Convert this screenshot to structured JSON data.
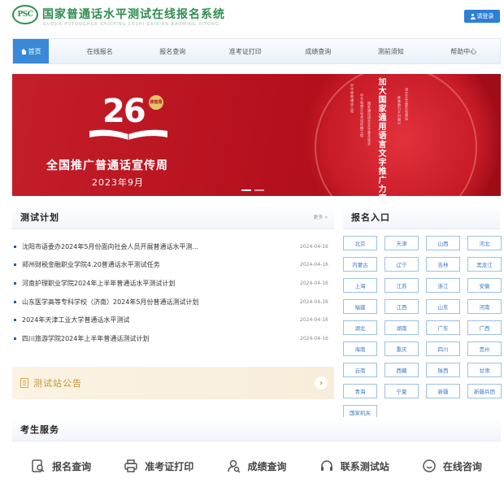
{
  "header": {
    "logo_text": "PSC",
    "title": "国家普通话水平测试在线报名系统",
    "subtitle": "GUOJIA PUTONGHUA SHUIPING CESHI ZAIXIAN BAOMING XITONG",
    "login_label": "请登录"
  },
  "nav": {
    "items": [
      {
        "label": "首页",
        "active": true
      },
      {
        "label": "在线报名"
      },
      {
        "label": "报名查询"
      },
      {
        "label": "准考证打印"
      },
      {
        "label": "成绩查询"
      },
      {
        "label": "测前须知"
      },
      {
        "label": "帮助中心"
      }
    ]
  },
  "banner": {
    "number": "26",
    "seal": "推普周",
    "title": "全国推广普通话宣传周",
    "date": "2023年9月",
    "vertical_main": "加大国家通用语言文字推广力度",
    "vertical_lines": [
      "中华经典诵读工程",
      "中华思想文化术语传播工程",
      "国家通用语言文字普及攻坚",
      "推普助力乡村振兴",
      "语言文字规范化建设"
    ],
    "slides": 2,
    "active_slide": 0
  },
  "plan": {
    "title": "测试计划",
    "more": "更多 »",
    "items": [
      {
        "text": "沈阳市语委办2024年5月份面向社会人员开展普通话水平测...",
        "date": "2024-04-16"
      },
      {
        "text": "郑州财税金融职业学院4.20普通话水平测试任务",
        "date": "2024-04-16"
      },
      {
        "text": "河南护理职业学院2024年上半年普通话水平测试计划",
        "date": "2024-04-16"
      },
      {
        "text": "山东医学高等专科学校（济南）2024年5月份普通话测试计划",
        "date": "2024-04-16"
      },
      {
        "text": "2024年天津工业大学普通话水平测试",
        "date": "2024-04-16"
      },
      {
        "text": "四川旅游学院2024年上半年普通话测试计划",
        "date": "2024-04-16"
      }
    ]
  },
  "notice": {
    "title": "测试站公告",
    "arrow": "›"
  },
  "registration": {
    "title": "报名入口",
    "regions": [
      "北京",
      "天津",
      "山西",
      "河北",
      "内蒙古",
      "辽宁",
      "吉林",
      "黑龙江",
      "上海",
      "江苏",
      "浙江",
      "安徽",
      "福建",
      "江西",
      "山东",
      "河南",
      "湖北",
      "湖南",
      "广东",
      "广西",
      "海南",
      "重庆",
      "四川",
      "贵州",
      "云南",
      "西藏",
      "陕西",
      "甘肃",
      "青海",
      "宁夏",
      "新疆",
      "新疆兵团",
      "国家机关"
    ]
  },
  "services": {
    "title": "考生服务",
    "items": [
      {
        "label": "报名查询",
        "icon": "search-doc-icon"
      },
      {
        "label": "准考证打印",
        "icon": "printer-icon"
      },
      {
        "label": "成绩查询",
        "icon": "user-search-icon"
      },
      {
        "label": "联系测试站",
        "icon": "headset-icon"
      },
      {
        "label": "在线咨询",
        "icon": "chat-icon"
      }
    ]
  },
  "colors": {
    "brand_green": "#2f8e4e",
    "nav_active": "#3a89d8",
    "banner_red": "#b5101d",
    "region_blue": "#3a7bc8",
    "notice_gold": "#c8912d"
  }
}
